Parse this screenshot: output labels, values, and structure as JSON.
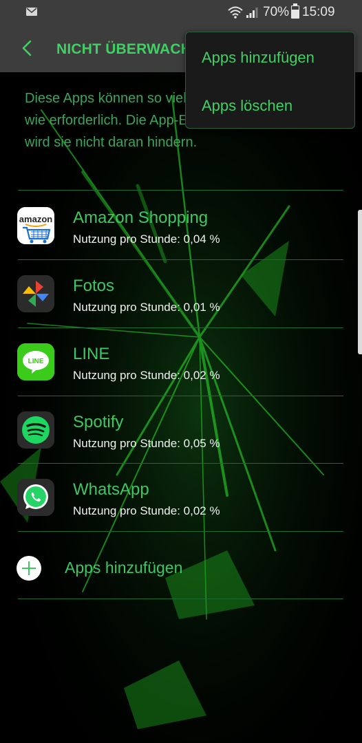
{
  "status_bar": {
    "battery": "70%",
    "time": "15:09"
  },
  "app_bar": {
    "title": "NICHT ÜBERWACHTE APPS"
  },
  "menu": {
    "items": [
      {
        "label": "Apps hinzufügen"
      },
      {
        "label": "Apps löschen"
      }
    ]
  },
  "description": "Diese Apps können so viel Energie verbrauchen, wie erforderlich. Die App-Energieüberwachung wird sie nicht daran hindern.",
  "apps": [
    {
      "name": "Amazon Shopping",
      "usage": "Nutzung pro Stunde: 0,04 %",
      "icon": "amazon-icon"
    },
    {
      "name": "Fotos",
      "usage": "Nutzung pro Stunde: 0,01 %",
      "icon": "photos-pinwheel-icon"
    },
    {
      "name": "LINE",
      "usage": "Nutzung pro Stunde: 0,02 %",
      "icon": "line-icon"
    },
    {
      "name": "Spotify",
      "usage": "Nutzung pro Stunde: 0,05 %",
      "icon": "spotify-icon"
    },
    {
      "name": "WhatsApp",
      "usage": "Nutzung pro Stunde: 0,02 %",
      "icon": "whatsapp-icon"
    }
  ],
  "add_apps": {
    "label": "Apps hinzufügen"
  },
  "icon_logo_text": {
    "amazon": "amazon",
    "line": "LINE"
  },
  "colors": {
    "accent_green": "#3fc762",
    "bar_background": "#3d3d3d",
    "background": "#000000"
  }
}
